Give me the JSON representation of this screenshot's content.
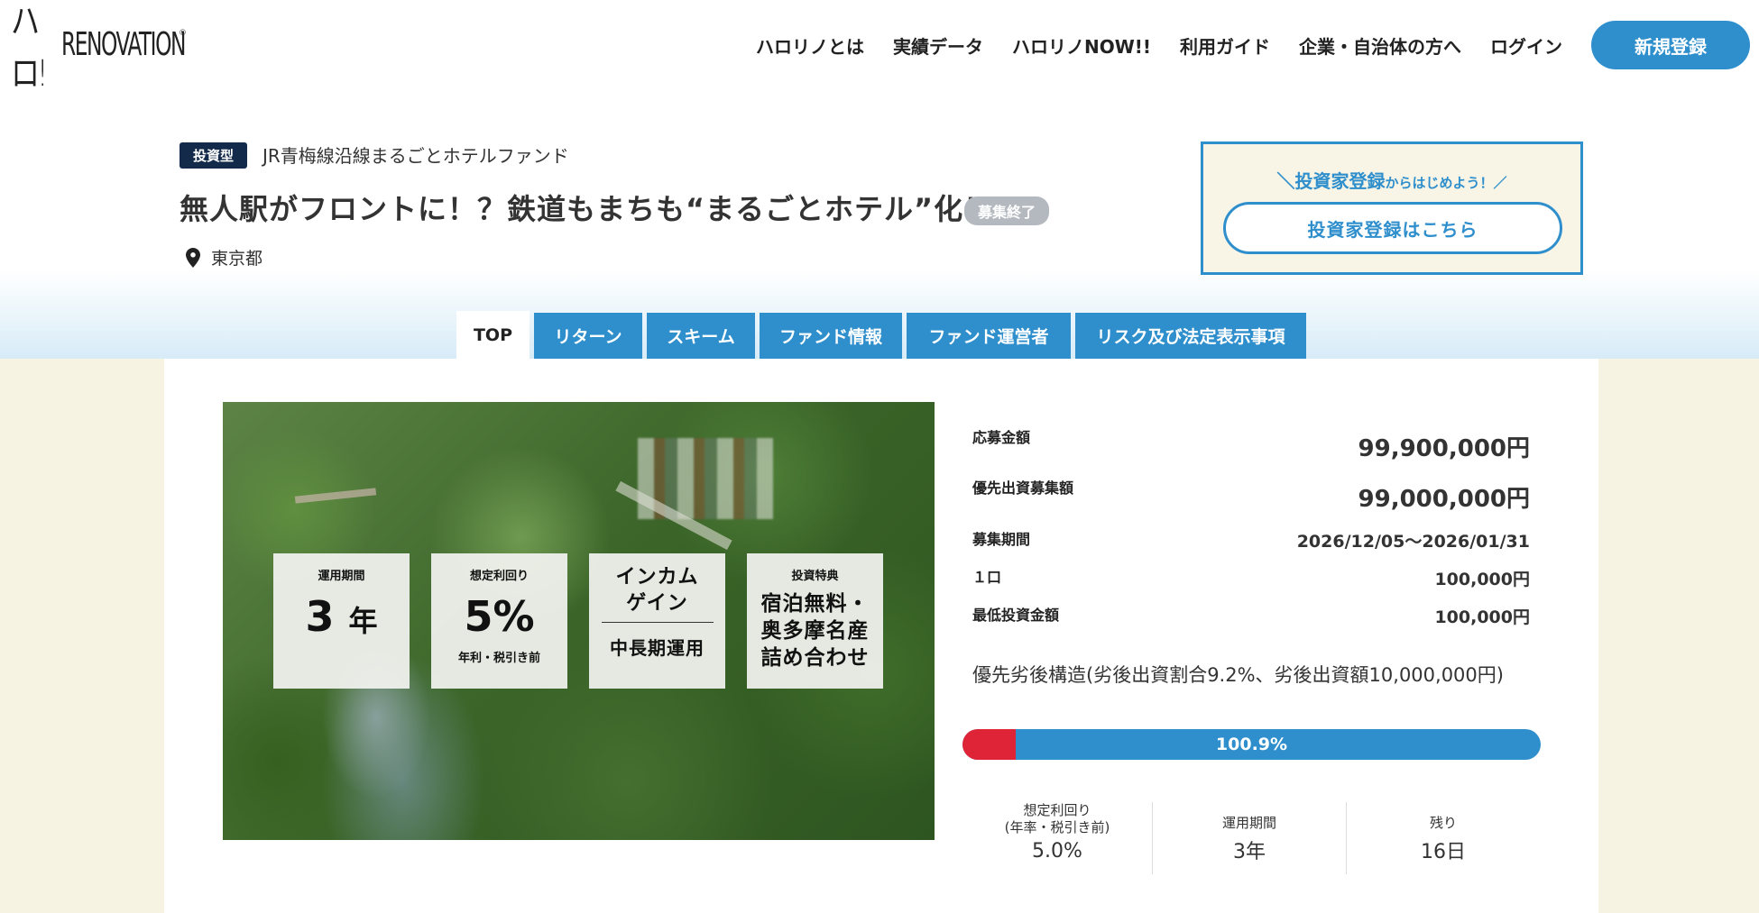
{
  "header": {
    "logo_mark": "ハロ!",
    "logo_text": "RENOVATION",
    "logo_reg": "®",
    "nav": [
      "ハロリノとは",
      "実績データ",
      "ハロリノNOW!!",
      "利用ガイド",
      "企業・自治体の方へ",
      "ログイン"
    ],
    "signup": "新規登録"
  },
  "fund": {
    "type": "投資型",
    "name": "JR青梅線沿線まるごとホテルファンド",
    "title": "無人駅がフロントに！？鉄道もまちも“まるごとホテル”化！",
    "status": "募集終了",
    "location": "東京都"
  },
  "investor": {
    "lead_main": "＼投資家登録",
    "lead_small": "からはじめよう！／",
    "button": "投資家登録はこちら"
  },
  "tabs": [
    "TOP",
    "リターン",
    "スキーム",
    "ファンド情報",
    "ファンド運営者",
    "リスク及び法定表示事項"
  ],
  "hero": {
    "card1": {
      "label": "運用期間",
      "value": "3",
      "unit": "年"
    },
    "card2": {
      "label": "想定利回り",
      "value": "5%",
      "sub": "年利・税引き前"
    },
    "card3": {
      "line1": "インカム",
      "line2": "ゲイン",
      "sub": "中長期運用"
    },
    "card4": {
      "label": "投資特典",
      "line1": "宿泊無料・",
      "line2": "奥多摩名産",
      "line3": "詰め合わせ"
    }
  },
  "stats": {
    "applied_label": "応募金額",
    "applied_value": "99,900,000円",
    "priority_label": "優先出資募集額",
    "priority_value": "99,000,000円",
    "period_label": "募集期間",
    "period_value": "2026/12/05〜2026/01/31",
    "unit_label": "１口",
    "unit_value": "100,000円",
    "min_label": "最低投資金額",
    "min_value": "100,000円",
    "structure": "優先劣後構造(劣後出資割合9.2%、劣後出資額10,000,000円)"
  },
  "progress": {
    "percent_text": "100.9%",
    "subordinate_fraction": 0.092
  },
  "summary": {
    "yield_label1": "想定利回り",
    "yield_label2": "(年率・税引き前)",
    "yield_value": "5.0%",
    "term_label": "運用期間",
    "term_value": "3年",
    "remain_label": "残り",
    "remain_value": "16日"
  },
  "colors": {
    "accent": "#2f8fcc",
    "navy": "#132a4a",
    "red": "#e02437",
    "cream": "#f7f3e3"
  }
}
